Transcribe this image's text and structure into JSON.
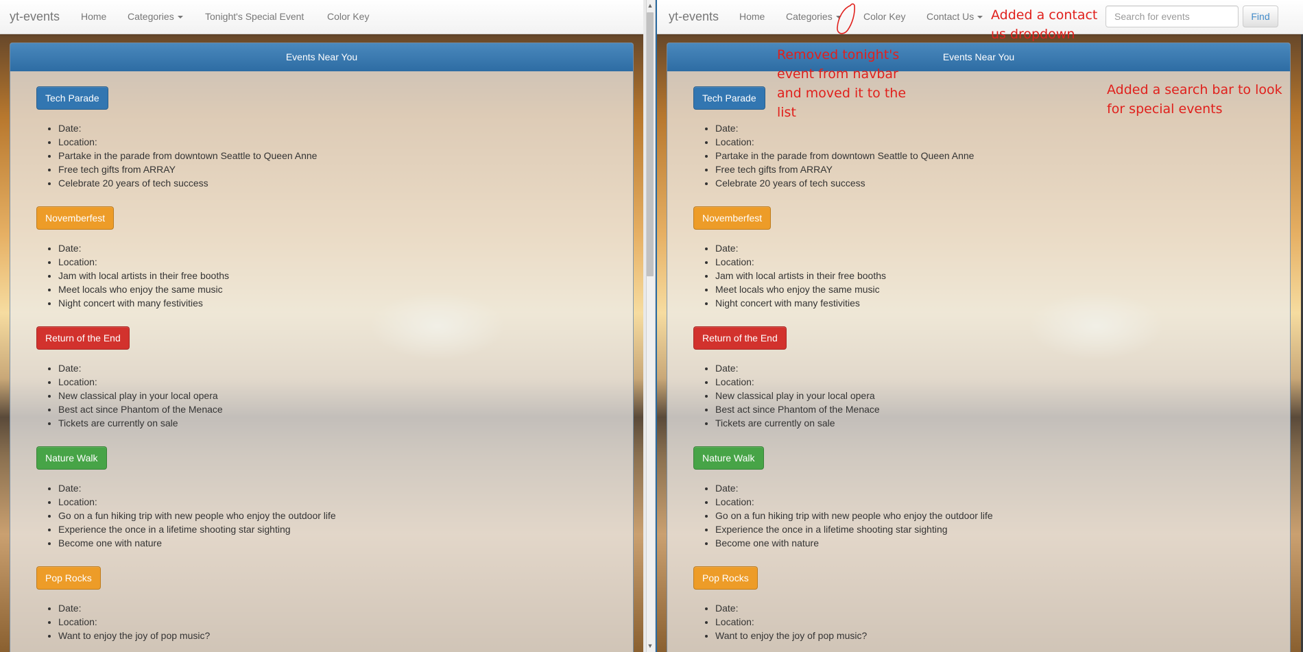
{
  "left": {
    "navbar": {
      "brand": "yt-events",
      "items": [
        "Home",
        "Categories",
        "Tonight's Special Event",
        "Color Key"
      ]
    },
    "panel_title": "Events Near You"
  },
  "right": {
    "navbar": {
      "brand": "yt-events",
      "items": [
        "Home",
        "Categories",
        "Color Key",
        "Contact Us"
      ],
      "search_placeholder": "Search for events",
      "find_label": "Find"
    },
    "panel_title": "Events Near You"
  },
  "events": [
    {
      "name": "Tech Parade",
      "color": "#3276b1",
      "details": [
        "Date:",
        "Location:",
        "Partake in the parade from downtown Seattle to Queen Anne",
        "Free tech gifts from ARRAY",
        "Celebrate 20 years of tech success"
      ]
    },
    {
      "name": "Novemberfest",
      "color": "#ed9c28",
      "details": [
        "Date:",
        "Location:",
        "Jam with local artists in their free booths",
        "Meet locals who enjoy the same music",
        "Night concert with many festivities"
      ]
    },
    {
      "name": "Return of the End",
      "color": "#d2322d",
      "details": [
        "Date:",
        "Location:",
        "New classical play in your local opera",
        "Best act since Phantom of the Menace",
        "Tickets are currently on sale"
      ]
    },
    {
      "name": "Nature Walk",
      "color": "#47a447",
      "details": [
        "Date:",
        "Location:",
        "Go on a fun hiking trip with new people who enjoy the outdoor life",
        "Experience the once in a lifetime shooting star sighting",
        "Become one with nature"
      ]
    },
    {
      "name": "Pop Rocks",
      "color": "#ed9c28",
      "details": [
        "Date:",
        "Location:",
        "Want to enjoy the joy of pop music?"
      ]
    }
  ],
  "annotations": {
    "contact": "Added a contact us dropdown",
    "tonight": "Removed tonight's event from navbar and moved it to the list",
    "search": "Added a search bar to look for special events"
  },
  "scroll_arrows": {
    "up": "▲",
    "down": "▼"
  }
}
